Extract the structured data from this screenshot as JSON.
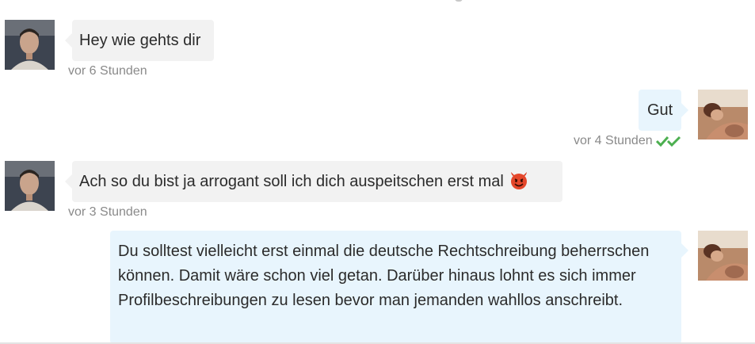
{
  "messages": [
    {
      "direction": "incoming",
      "text": "Hey wie gehts dir",
      "time": "vor 6 Stunden"
    },
    {
      "direction": "outgoing",
      "text": "Gut",
      "time": "vor 4 Stunden",
      "status": "read"
    },
    {
      "direction": "incoming",
      "text": "Ach so du bist ja arrogant soll ich dich auspeitschen erst mal",
      "emoji": "smiling-devil-icon",
      "time": "vor 3 Stunden"
    },
    {
      "direction": "outgoing",
      "text": "Du solltest vielleicht erst einmal die deutsche Rechtschreibung beherrschen können. Damit wäre schon viel getan. Darüber hinaus lohnt es sich immer Profilbeschreibungen zu lesen bevor man jemanden wahllos anschreibt."
    }
  ],
  "colors": {
    "incoming_bubble": "#f2f2f2",
    "outgoing_bubble": "#e8f5fd",
    "read_ticks": "#4caf50",
    "timestamp": "#8a8a8a"
  }
}
